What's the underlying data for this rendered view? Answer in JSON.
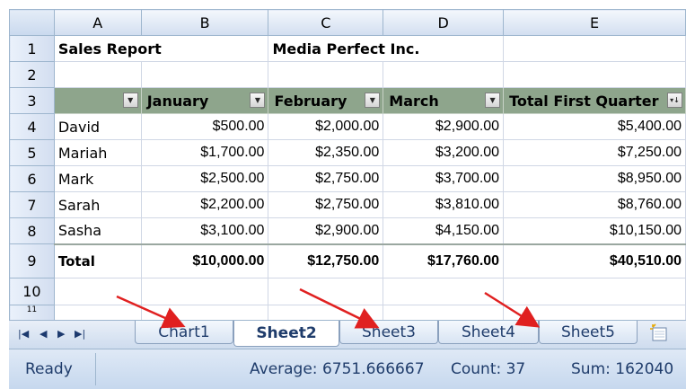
{
  "columns": [
    "A",
    "B",
    "C",
    "D",
    "E"
  ],
  "row_numbers": [
    "1",
    "2",
    "3",
    "4",
    "5",
    "6",
    "7",
    "8",
    "9",
    "10",
    "11"
  ],
  "title_row": {
    "a1": "Sales Report",
    "c1": "Media Perfect Inc."
  },
  "table_headers": [
    "January",
    "February",
    "March",
    "Total First Quarter"
  ],
  "rows": [
    {
      "name": "David",
      "jan": "$500.00",
      "feb": "$2,000.00",
      "mar": "$2,900.00",
      "total": "$5,400.00"
    },
    {
      "name": "Mariah",
      "jan": "$1,700.00",
      "feb": "$2,350.00",
      "mar": "$3,200.00",
      "total": "$7,250.00"
    },
    {
      "name": "Mark",
      "jan": "$2,500.00",
      "feb": "$2,750.00",
      "mar": "$3,700.00",
      "total": "$8,950.00"
    },
    {
      "name": "Sarah",
      "jan": "$2,200.00",
      "feb": "$2,750.00",
      "mar": "$3,810.00",
      "total": "$8,760.00"
    },
    {
      "name": "Sasha",
      "jan": "$3,100.00",
      "feb": "$2,900.00",
      "mar": "$4,150.00",
      "total": "$10,150.00"
    }
  ],
  "totals": {
    "label": "Total",
    "jan": "$10,000.00",
    "feb": "$12,750.00",
    "mar": "$17,760.00",
    "total": "$40,510.00"
  },
  "tabs": {
    "nav": [
      "first-sheet",
      "prev-sheet",
      "next-sheet",
      "last-sheet"
    ],
    "items": [
      "Chart1",
      "Sheet2",
      "Sheet3",
      "Sheet4",
      "Sheet5"
    ],
    "active": "Sheet2",
    "new_sheet_icon": "insert-worksheet-icon"
  },
  "status": {
    "ready": "Ready",
    "average": "Average: 6751.666667",
    "count": "Count: 37",
    "sum": "Sum: 162040"
  },
  "colors": {
    "header_fill": "#8ea58c",
    "annotation_arrow": "#e02020",
    "tab_text": "#1f3c6b"
  }
}
